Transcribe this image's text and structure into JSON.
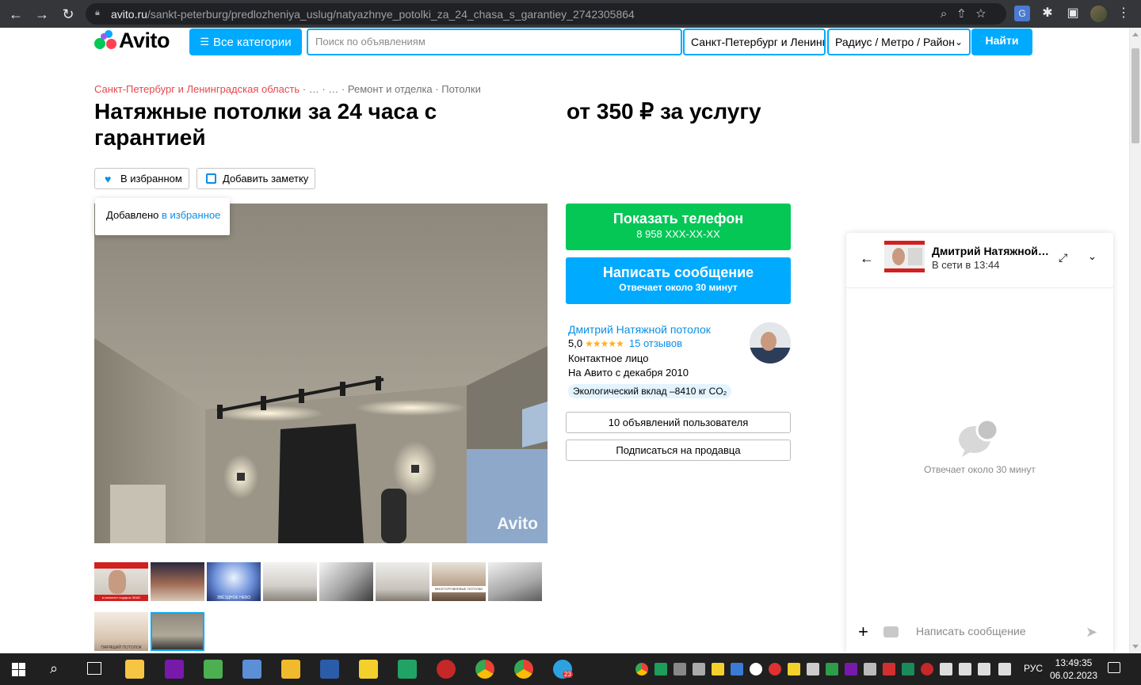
{
  "browser": {
    "url_domain": "avito.ru",
    "url_path": "/sankt-peterburg/predlozheniya_uslug/natyazhnye_potolki_za_24_chasa_s_garantiey_2742305864"
  },
  "header": {
    "logo_text": "Avito",
    "categories_label": "Все категории",
    "search_placeholder": "Поиск по объявлениям",
    "region_value": "Санкт-Петербург и Ленинградская область",
    "radius_label": "Радиус / Метро / Район",
    "find_label": "Найти"
  },
  "breadcrumbs": {
    "region": "Санкт-Петербург и Ленинградская область",
    "sep1": "·",
    "item2": "…",
    "sep2": "·",
    "item3": "…",
    "sep3": "·",
    "item4": "Ремонт и отделка",
    "sep4": "·",
    "item5": "Потолки"
  },
  "listing": {
    "title": "Натяжные потолки за 24 часа с гарантией",
    "price": "от 350 ₽ за услугу",
    "fav_label": "В избранном",
    "note_label": "Добавить заметку",
    "tooltip_prefix": "Добавлено",
    "tooltip_link": "в избранное",
    "photo_watermark": "Avito",
    "thumbs": [
      {
        "caption": "в комплект подарок ЭКАО"
      },
      {
        "caption": ""
      },
      {
        "caption": "ЗВЁЗДНОЕ НЕБО"
      },
      {
        "caption": ""
      },
      {
        "caption": ""
      },
      {
        "caption": ""
      },
      {
        "caption": "МНОГОУРОВНЕВЫЕ ПОТОЛКИ"
      },
      {
        "caption": ""
      },
      {
        "caption": "ПАРЯЩИЙ ПОТОЛОК"
      },
      {
        "caption": ""
      }
    ]
  },
  "actions": {
    "phone_title": "Показать телефон",
    "phone_number": "8 958 XXX-XX-XX",
    "message_title": "Написать сообщение",
    "message_sub": "Отвечает около 30 минут",
    "listings_label": "10 объявлений пользователя",
    "subscribe_label": "Подписаться на продавца"
  },
  "seller": {
    "name": "Дмитрий Натяжной потолок",
    "rating": "5,0",
    "stars": 5,
    "reviews": "15 отзывов",
    "contact": "Контактное лицо",
    "since": "На Авито с декабря 2010",
    "eco": "Экологический вклад –8410 кг CO₂"
  },
  "chat": {
    "name": "Дмитрий Натяжной потолок",
    "status": "В сети в 13:44",
    "hint": "Отвечает около 30 минут",
    "input_placeholder": "Написать сообщение"
  },
  "taskbar": {
    "lang": "РУС",
    "time": "13:49:35",
    "date": "06.02.2023",
    "telegram_badge": "23"
  },
  "colors": {
    "accent": "#00aaff",
    "phone_green": "#04c756",
    "link": "#0a8fe6",
    "breadcrumb_red": "#e8474c"
  }
}
